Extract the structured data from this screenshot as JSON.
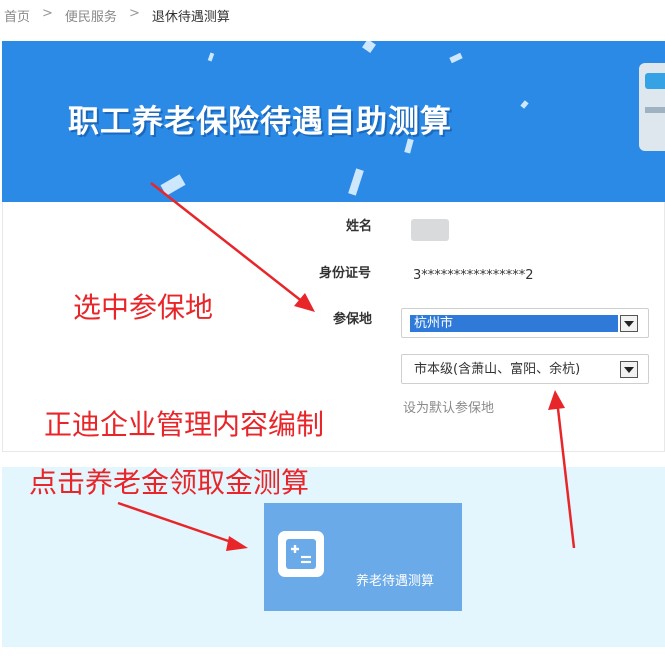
{
  "breadcrumb": {
    "home": "首页",
    "section": "便民服务",
    "current": "退休待遇测算",
    "separator": ">"
  },
  "banner": {
    "title": "职工养老保险待遇自助测算"
  },
  "form": {
    "name_label": "姓名",
    "id_label": "身份证号",
    "id_value": "3****************2",
    "region_label": "参保地",
    "city_select": {
      "selected": "杭州市"
    },
    "district_select": {
      "selected": "市本级(含萧山、富阳、余杭)"
    },
    "default_link": "设为默认参保地"
  },
  "calculator": {
    "tile_label": "养老待遇测算",
    "icon": "calculator-icon"
  },
  "annotations": {
    "select_region": "选中参保地",
    "watermark": "正迪企业管理内容编制",
    "click_hint": "点击养老金领取金测算"
  },
  "colors": {
    "banner_blue": "#2a8ae6",
    "tile_blue": "#6aaae8",
    "annotation_red": "#e8262a",
    "lower_panel": "#e4f6fd",
    "select_highlight": "#2f7ad9"
  }
}
